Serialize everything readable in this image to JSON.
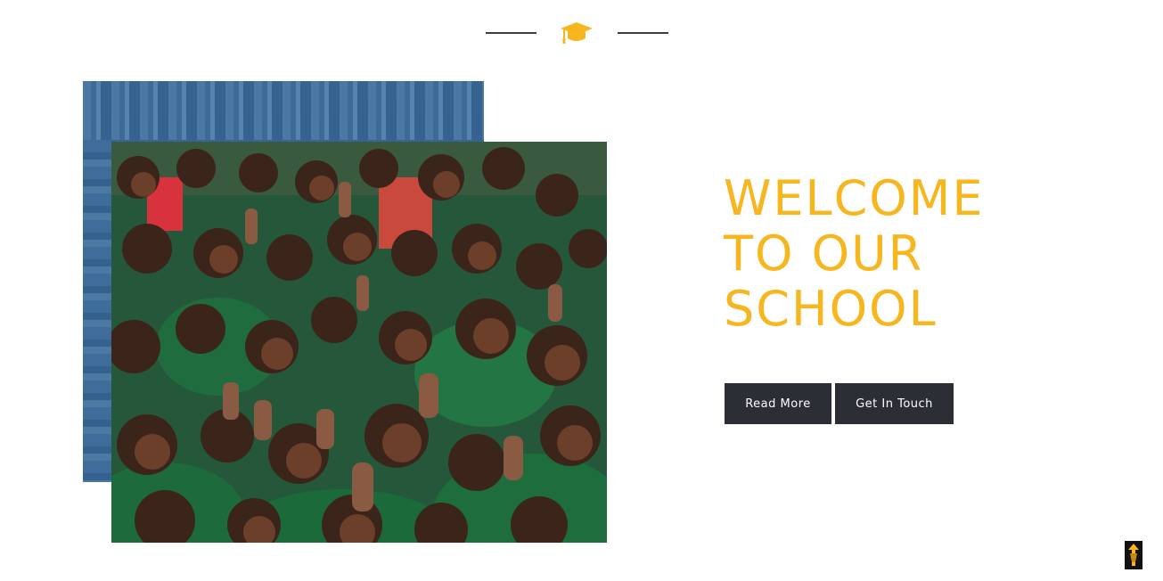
{
  "header": {
    "icon": "graduation-cap-icon",
    "icon_color": "#f7b51e",
    "line_color": "#3a3d44"
  },
  "images": {
    "back": "library-bookshelf-photo",
    "front": "schoolchildren-thumbs-up-photo"
  },
  "hero": {
    "title_lines": [
      "WELCOME",
      "TO OUR",
      "SCHOOL"
    ],
    "title_color": "#f7b51e",
    "buttons": {
      "read_more": "Read More",
      "get_in_touch": "Get In Touch"
    },
    "button_color": "#2b2e34"
  },
  "scroll_top": {
    "icon": "pen-nib-up-icon",
    "color": "#f7b51e"
  }
}
